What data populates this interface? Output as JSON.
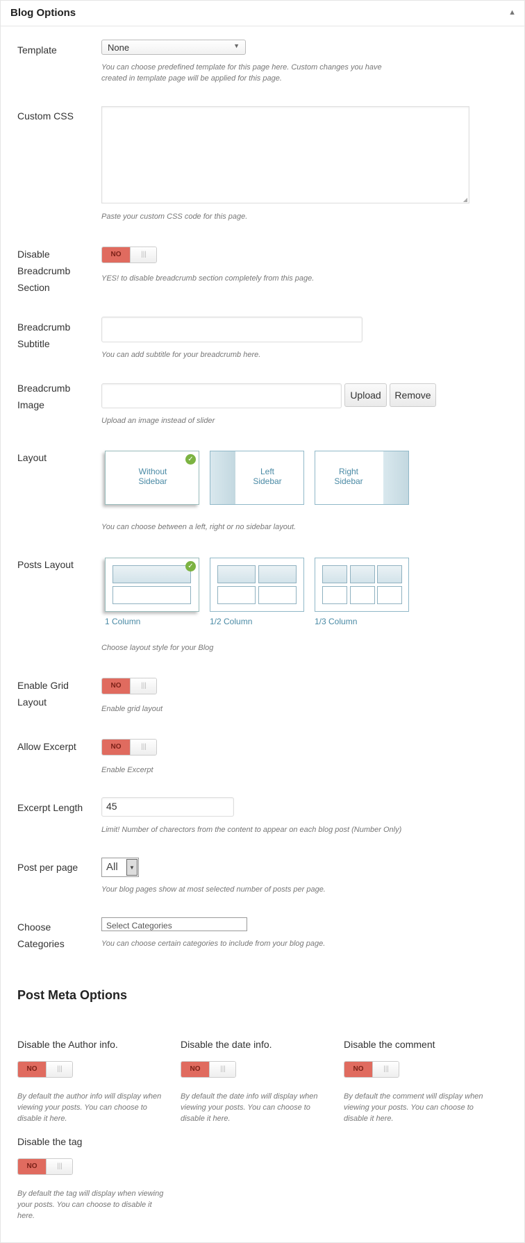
{
  "panel": {
    "title": "Blog Options",
    "collapse_glyph": "▲"
  },
  "template": {
    "label": "Template",
    "value": "None",
    "desc": "You can choose predefined template for this page here. Custom changes you have created in template page will be applied for this page."
  },
  "custom_css": {
    "label": "Custom CSS",
    "value": "",
    "desc": "Paste your custom CSS code for this page."
  },
  "breadcrumb_section": {
    "label": "Disable Breadcrumb Section",
    "toggle": "NO",
    "desc": "YES! to disable breadcrumb section completely from this page."
  },
  "breadcrumb_subtitle": {
    "label": "Breadcrumb Subtitle",
    "value": "",
    "desc": "You can add subtitle for your breadcrumb here."
  },
  "breadcrumb_image": {
    "label": "Breadcrumb Image",
    "value": "",
    "upload_label": "Upload",
    "remove_label": "Remove",
    "desc": "Upload an image instead of slider"
  },
  "layout": {
    "label": "Layout",
    "options": [
      "Without Sidebar",
      "Left Sidebar",
      "Right Sidebar"
    ],
    "selected": "Without Sidebar",
    "desc": "You can choose between a left, right or no sidebar layout."
  },
  "posts_layout": {
    "label": "Posts Layout",
    "options": [
      "1 Column",
      "1/2 Column",
      "1/3 Column"
    ],
    "selected": "1 Column",
    "desc": "Choose layout style for your Blog"
  },
  "grid_layout": {
    "label": "Enable Grid Layout",
    "toggle": "NO",
    "desc": "Enable grid layout"
  },
  "excerpt": {
    "label": "Allow Excerpt",
    "toggle": "NO",
    "desc": "Enable Excerpt"
  },
  "excerpt_length": {
    "label": "Excerpt Length",
    "value": "45",
    "desc": "Limit! Number of charectors from the content to appear on each blog post (Number Only)"
  },
  "post_per_page": {
    "label": "Post per page",
    "value": "All",
    "desc": "Your blog pages show at most selected number of posts per page."
  },
  "categories": {
    "label": "Choose Categories",
    "placeholder": "Select Categories",
    "desc": "You can choose certain categories to include from your blog page."
  },
  "post_meta": {
    "title": "Post Meta Options",
    "items": [
      {
        "label": "Disable the Author info.",
        "toggle": "NO",
        "desc": "By default the author info will display when viewing your posts. You can choose to disable it here."
      },
      {
        "label": "Disable the date info.",
        "toggle": "NO",
        "desc": "By default the date info will display when viewing your posts. You can choose to disable it here."
      },
      {
        "label": "Disable the comment",
        "toggle": "NO",
        "desc": "By default the comment will display when viewing your posts. You can choose to disable it here."
      },
      {
        "label": "Disable the tag",
        "toggle": "NO",
        "desc": "By default the tag will display when viewing your posts. You can choose to disable it here."
      }
    ]
  },
  "toggle_grip": "|||",
  "icons": {
    "check": "check-icon",
    "dropdown": "dropdown-arrow-icon",
    "resize": "resize-grip-icon"
  }
}
